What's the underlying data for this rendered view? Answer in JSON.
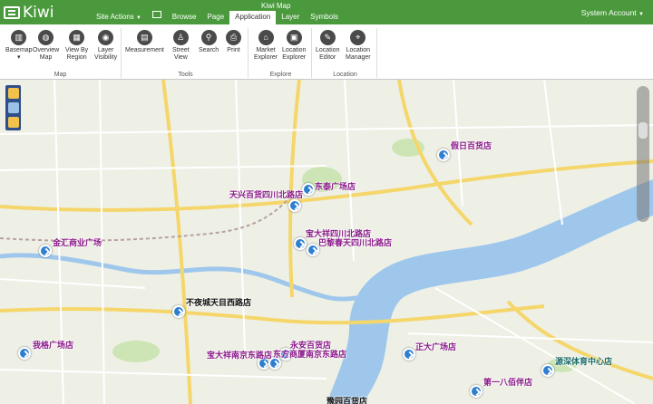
{
  "app": {
    "logo": "Kiwi",
    "title": "Kiwi Map"
  },
  "nav": {
    "site_actions": "Site Actions",
    "tabs": [
      "Browse",
      "Page",
      "Application",
      "Layer",
      "Symbols"
    ],
    "active_tab": "Application",
    "account": "System Account"
  },
  "ribbon": {
    "groups": [
      {
        "label": "Map",
        "buttons": [
          "Basemap",
          "Overview\nMap",
          "View By\nRegion",
          "Layer\nVisibility"
        ]
      },
      {
        "label": "Tools",
        "buttons": [
          "Measurement",
          "Street\nView",
          "Search",
          "Print"
        ]
      },
      {
        "label": "Explore",
        "buttons": [
          "Market\nExplorer",
          "Location\nExplorer"
        ]
      },
      {
        "label": "Location",
        "buttons": [
          "Location\nEditor",
          "Location\nManager"
        ]
      }
    ]
  },
  "map": {
    "stores": [
      {
        "name": "假日百货店",
        "style": "purple"
      },
      {
        "name": "东泰广场店",
        "style": "purple"
      },
      {
        "name": "天兴百货四川北路店",
        "style": "purple"
      },
      {
        "name": "宝大祥四川北路店",
        "style": "purple"
      },
      {
        "name": "巴黎春天四川北路店",
        "style": "purple"
      },
      {
        "name": "金汇商业广场",
        "style": "purple"
      },
      {
        "name": "不夜城天目西路店",
        "style": "dark"
      },
      {
        "name": "我格广场店",
        "style": "purple"
      },
      {
        "name": "永安百货店",
        "style": "purple"
      },
      {
        "name": "宝大祥南京东路店",
        "style": "purple"
      },
      {
        "name": "东方商厦南京东路店",
        "style": "purple"
      },
      {
        "name": "正大广场店",
        "style": "purple"
      },
      {
        "name": "第一八佰伴店",
        "style": "purple"
      },
      {
        "name": "源深体育中心店",
        "style": "teal"
      },
      {
        "name": "豫园百货店",
        "style": "dark"
      }
    ]
  }
}
